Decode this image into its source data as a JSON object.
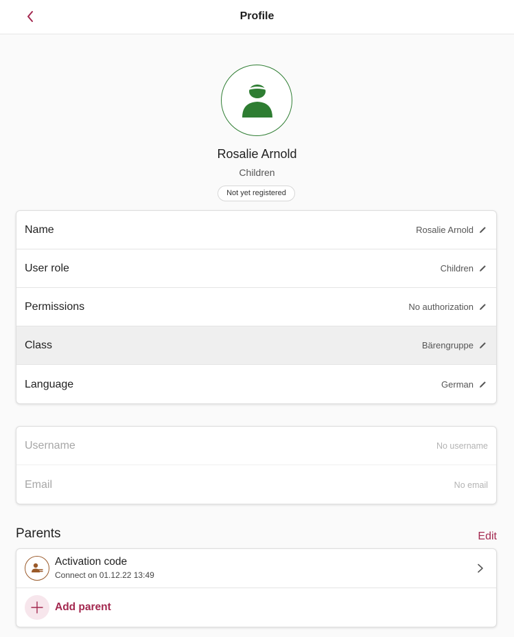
{
  "header": {
    "title": "Profile"
  },
  "profile": {
    "name": "Rosalie Arnold",
    "role": "Children",
    "status": "Not yet registered"
  },
  "details": [
    {
      "label": "Name",
      "value": "Rosalie Arnold"
    },
    {
      "label": "User role",
      "value": "Children"
    },
    {
      "label": "Permissions",
      "value": "No authorization"
    },
    {
      "label": "Class",
      "value": "Bärengruppe"
    },
    {
      "label": "Language",
      "value": "German"
    }
  ],
  "account": [
    {
      "label": "Username",
      "value": "No username"
    },
    {
      "label": "Email",
      "value": "No email"
    }
  ],
  "parents": {
    "title": "Parents",
    "edit_label": "Edit",
    "activation": {
      "title": "Activation code",
      "subtitle": "Connect on 01.12.22 13:49"
    },
    "add_label": "Add parent"
  },
  "colors": {
    "accent": "#a3284f",
    "avatar_green": "#2e7d32",
    "parent_brown": "#9a5a2a"
  },
  "icons": {
    "back": "chevron-left-icon",
    "edit": "pencil-icon",
    "avatar": "child-avatar-icon",
    "parent": "parent-user-icon",
    "forward": "chevron-right-icon",
    "add": "plus-icon"
  }
}
